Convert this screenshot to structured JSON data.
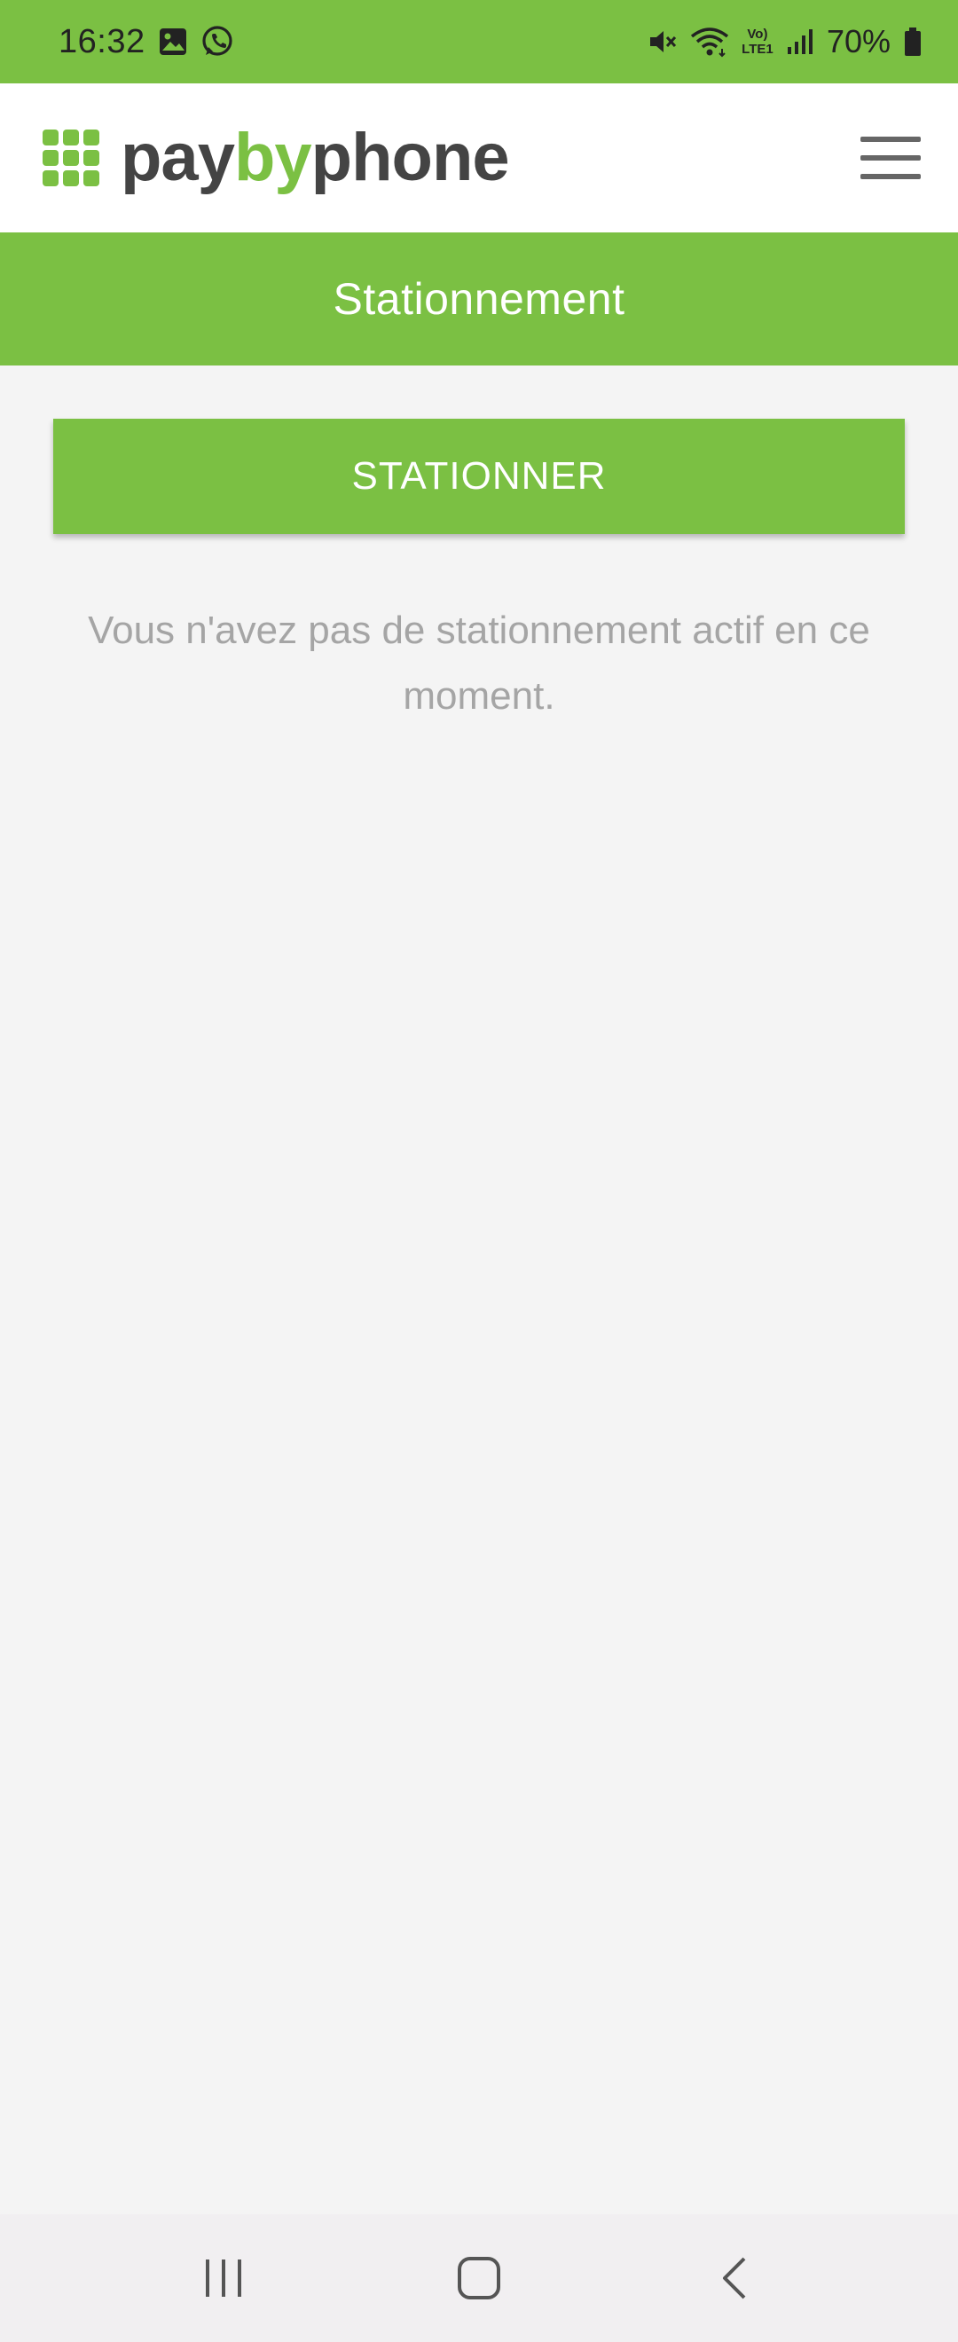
{
  "status_bar": {
    "time": "16:32",
    "battery": "70%",
    "network_label": "Vo) LTE1",
    "icons_left": [
      "gallery-icon",
      "whatsapp-icon"
    ],
    "icons_right": [
      "mute-icon",
      "wifi-icon",
      "volte-icon",
      "signal-icon",
      "battery-icon"
    ]
  },
  "header": {
    "logo_text_1": "pay",
    "logo_text_2": "by",
    "logo_text_3": "phone",
    "menu_icon": "hamburger-menu-icon"
  },
  "page": {
    "title": "Stationnement",
    "park_button_label": "STATIONNER",
    "empty_message": "Vous n'avez pas de stationnement actif en ce moment."
  },
  "nav_bar": {
    "items": [
      "recent-apps-icon",
      "home-icon",
      "back-icon"
    ]
  },
  "colors": {
    "brand_green": "#7bc043",
    "logo_gray": "#444444",
    "message_gray": "#a5a5a5",
    "background": "#f4f4f4"
  }
}
